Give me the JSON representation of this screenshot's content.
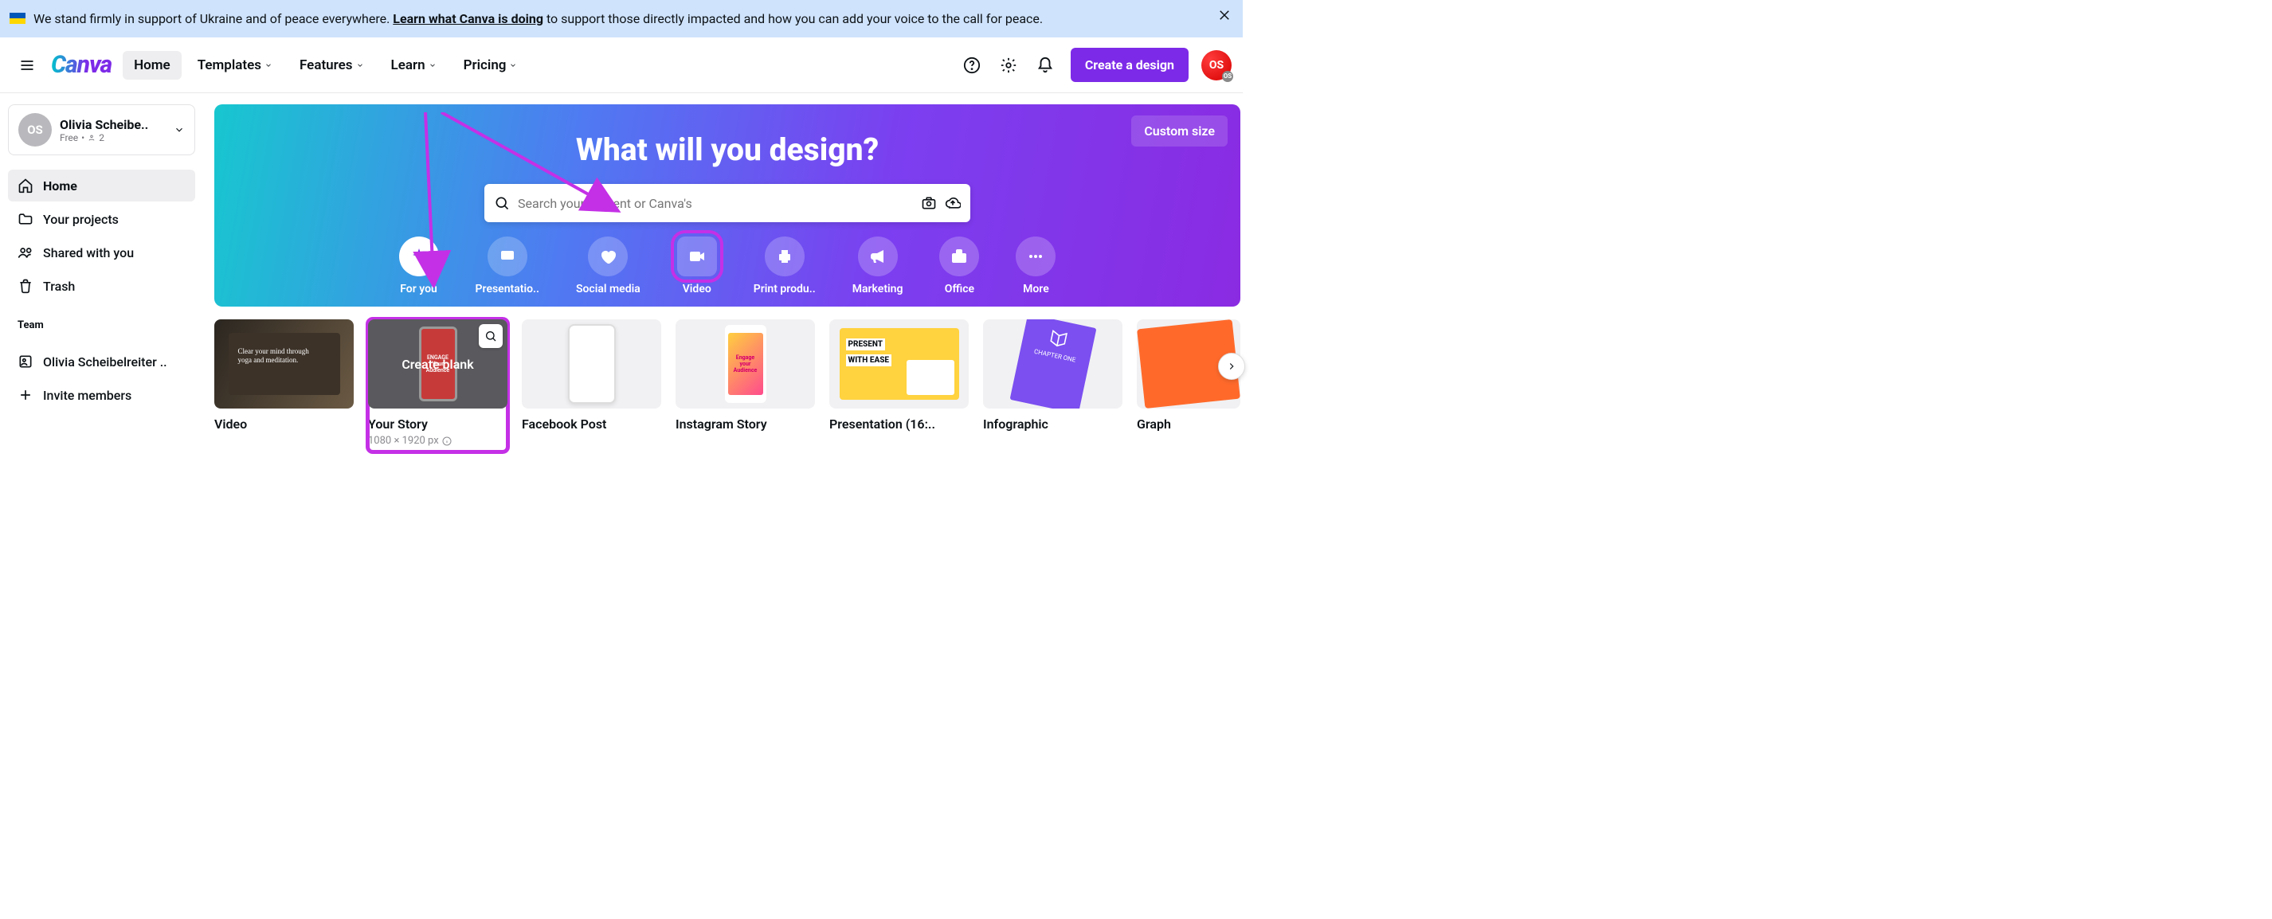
{
  "banner": {
    "text_before": "We stand firmly in support of Ukraine and of peace everywhere. ",
    "link": "Learn what Canva is doing",
    "text_after": " to support those directly impacted and how you can add your voice to the call for peace."
  },
  "nav": {
    "home": "Home",
    "templates": "Templates",
    "features": "Features",
    "learn": "Learn",
    "pricing": "Pricing",
    "create": "Create a design",
    "logo": "Canva",
    "avatar_initials": "OS",
    "avatar_sub": "OS"
  },
  "user": {
    "initials": "OS",
    "name": "Olivia Scheibe..",
    "plan": "Free",
    "members": "2"
  },
  "sidebar": {
    "home": "Home",
    "projects": "Your projects",
    "shared": "Shared with you",
    "trash": "Trash",
    "team_header": "Team",
    "team_name": "Olivia Scheibelreiter ..",
    "invite": "Invite members"
  },
  "hero": {
    "title": "What will you design?",
    "custom_size": "Custom size",
    "search_placeholder": "Search your content or Canva's"
  },
  "categories": {
    "for_you": "For you",
    "presentation": "Presentatio..",
    "social": "Social media",
    "video": "Video",
    "print": "Print produ..",
    "marketing": "Marketing",
    "office": "Office",
    "more": "More"
  },
  "templates": {
    "video": {
      "title": "Video"
    },
    "your_story": {
      "title": "Your Story",
      "dim": "1080 × 1920 px",
      "create_blank": "Create blank"
    },
    "fb": {
      "title": "Facebook Post"
    },
    "ig": {
      "title": "Instagram Story"
    },
    "pres": {
      "title": "Presentation (16:..",
      "thumb_a": "PRESENT",
      "thumb_b": "WITH EASE"
    },
    "info": {
      "title": "Infographic",
      "thumb": "CHAPTER ONE"
    },
    "graph": {
      "title": "Graph"
    },
    "ig_thumb_a": "Engage",
    "ig_thumb_b": "your",
    "ig_thumb_c": "Audience",
    "video_caption": "Clear your mind through yoga and meditation."
  }
}
